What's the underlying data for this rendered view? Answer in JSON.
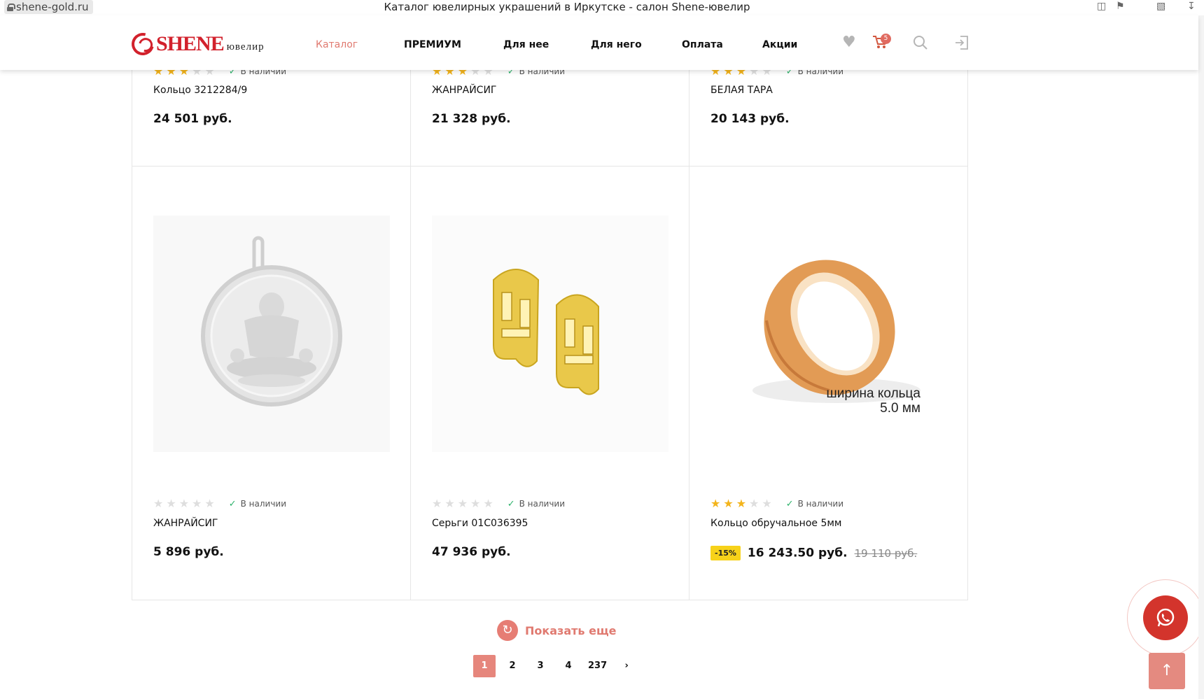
{
  "browser": {
    "url": "shene-gold.ru",
    "title": "Каталог ювелирных украшений в Иркутске - салон Shene-ювелир",
    "icons": [
      "tabs-icon",
      "bookmark-icon",
      "extensions-icon",
      "download-icon"
    ]
  },
  "header": {
    "logo_text": "SHENE",
    "logo_sub": "ювелир",
    "nav": [
      "Каталог",
      "ПРЕМИУМ",
      "Для нее",
      "Для него",
      "Оплата",
      "Акции"
    ],
    "active_nav": "Каталог",
    "cart_count": "5",
    "icons": [
      "heart-icon",
      "cart-icon",
      "search-icon",
      "login-icon"
    ]
  },
  "products": [
    {
      "name": "Кольцо 3212284/9",
      "price": "24 501 руб.",
      "rating": 3,
      "stock": "В наличии"
    },
    {
      "name": "ЖАНРАЙСИГ",
      "price": "21 328 руб.",
      "rating": 3,
      "stock": "В наличии"
    },
    {
      "name": "БЕЛАЯ ТАРА",
      "price": "20 143 руб.",
      "rating": 3,
      "stock": "В наличии"
    },
    {
      "name": "ЖАНРАЙСИГ",
      "price": "5 896 руб.",
      "rating": 0,
      "stock": "В наличии",
      "image": "silver-pendant"
    },
    {
      "name": "Серьги 01С036395",
      "price": "47 936 руб.",
      "rating": 0,
      "stock": "В наличии",
      "image": "gold-earrings"
    },
    {
      "name": "Кольцо обручальное 5мм",
      "price": "16 243.50 руб.",
      "old_price": "19 110 руб.",
      "discount": "-15%",
      "rating": 3,
      "stock": "В наличии",
      "image": "gold-ring",
      "image_caption_1": "ширина кольца",
      "image_caption_2": "5.0 мм"
    }
  ],
  "show_more": "Показать еще",
  "pagination": [
    "1",
    "2",
    "3",
    "4",
    "237"
  ],
  "current_page": "1",
  "colors": {
    "brand": "#d2212c",
    "accent": "#e07a70",
    "star": "#f3b41b",
    "discount": "#f7d21a"
  }
}
